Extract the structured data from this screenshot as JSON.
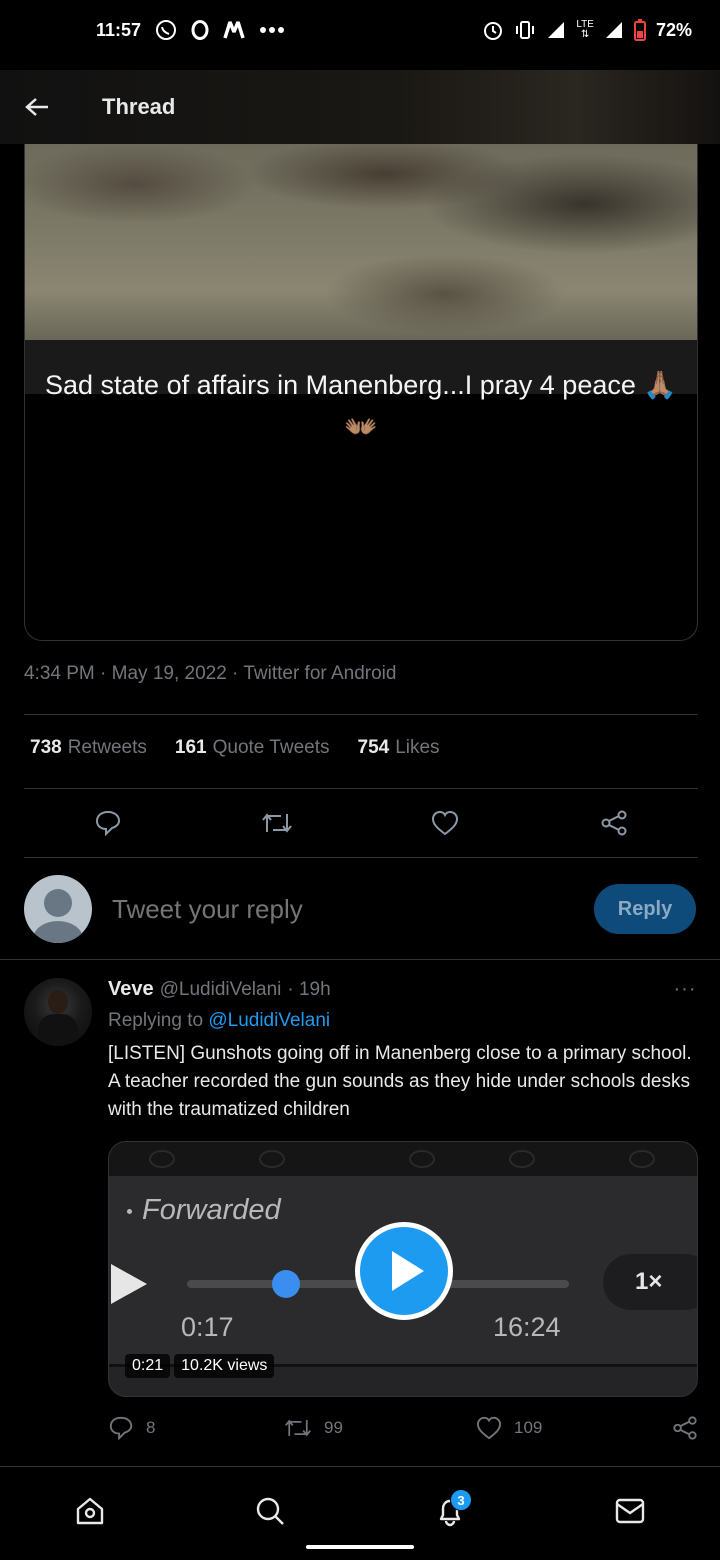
{
  "status_bar": {
    "time": "11:57",
    "left_icons": [
      "whatsapp-icon",
      "opera-icon",
      "news-icon",
      "more-dots-icon"
    ],
    "right_icons": [
      "alarm-icon",
      "vibrate-icon",
      "signal-icon",
      "lte-icon",
      "signal-icon",
      "battery-icon"
    ],
    "lte": "LTE",
    "battery": "72%"
  },
  "header": {
    "back_icon": "back-arrow-icon",
    "title": "Thread"
  },
  "main_tweet": {
    "media_caption": "Sad state of affairs in Manenberg...I pray 4 peace 🙏🏽👐🏽",
    "timestamp": "4:34 PM · May 19, 2022 · Twitter for Android",
    "stats": {
      "retweets_count": "738",
      "retweets_label": "Retweets",
      "quotes_count": "161",
      "quotes_label": "Quote Tweets",
      "likes_count": "754",
      "likes_label": "Likes"
    },
    "actions": [
      "comment-icon",
      "retweet-icon",
      "heart-icon",
      "share-icon"
    ]
  },
  "composer": {
    "placeholder": "Tweet your reply",
    "reply_button": "Reply"
  },
  "reply_tweet": {
    "name": "Veve",
    "handle": "@LudidiVelani",
    "age": "· 19h",
    "more": "···",
    "replying_prefix": "Replying to",
    "replying_to": "@LudidiVelani",
    "text": "[LISTEN] Gunshots going off in Manenberg close to a primary school. A teacher recorded the gun sounds as they hide under schools desks with the traumatized children",
    "video": {
      "forwarded": "Forwarded",
      "time_elapsed": "0:17",
      "time_total": "16:24",
      "speed": "1×",
      "progress_fraction": 0.26,
      "duration_chip": "0:21",
      "views_chip": "10.2K views"
    },
    "counts": {
      "comments": "8",
      "retweets": "99",
      "likes": "109"
    }
  },
  "bottom_nav": {
    "items": [
      "home-icon",
      "search-icon",
      "notifications-icon",
      "messages-icon"
    ],
    "notification_badge": "3"
  },
  "colors": {
    "accent": "#1d9bf0",
    "background": "#000000",
    "muted_text": "#71767b",
    "divider": "#2f3336"
  }
}
